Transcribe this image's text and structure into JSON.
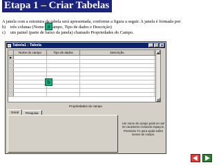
{
  "slide": {
    "title": "Etapa 1 – Criar Tabelas",
    "intro": "A janela com a estrutura da tabela será apresentada, conforme a figura a seguir. A janela é formada por:",
    "items": [
      {
        "label": "b)",
        "text": "três colunas (Nome do campo, Tipo de dados e Descrição)"
      },
      {
        "label": "c)",
        "text": "um painel (parte de baixo da janela) chamado Propriedades do Campo."
      }
    ]
  },
  "window": {
    "title": "Tabela1 : Tabela",
    "controls": [
      "_",
      "□",
      "x"
    ],
    "columns": [
      "Nome do campo",
      "Tipo de dados",
      "Descrição"
    ],
    "row_marker": "▶",
    "properties_label": "Propriedades do campo",
    "tabs": [
      "Geral",
      "Pesquisa"
    ],
    "help_text": "Um nome de campo pode ter até 64 caracteres incluindo espaços. Pressione F1 para ajuda sobre nomes de campo."
  },
  "markers": {
    "a": "a",
    "b": "b"
  },
  "colors": {
    "title_bg": "#1a237e",
    "marker": "#19a97a",
    "titlebar": "#0a246a",
    "nav_prev": "#e53935",
    "nav_next": "#2e7d32"
  },
  "nav": {
    "prev_icon": "arrow-left-icon",
    "next_icon": "arrow-right-icon"
  }
}
